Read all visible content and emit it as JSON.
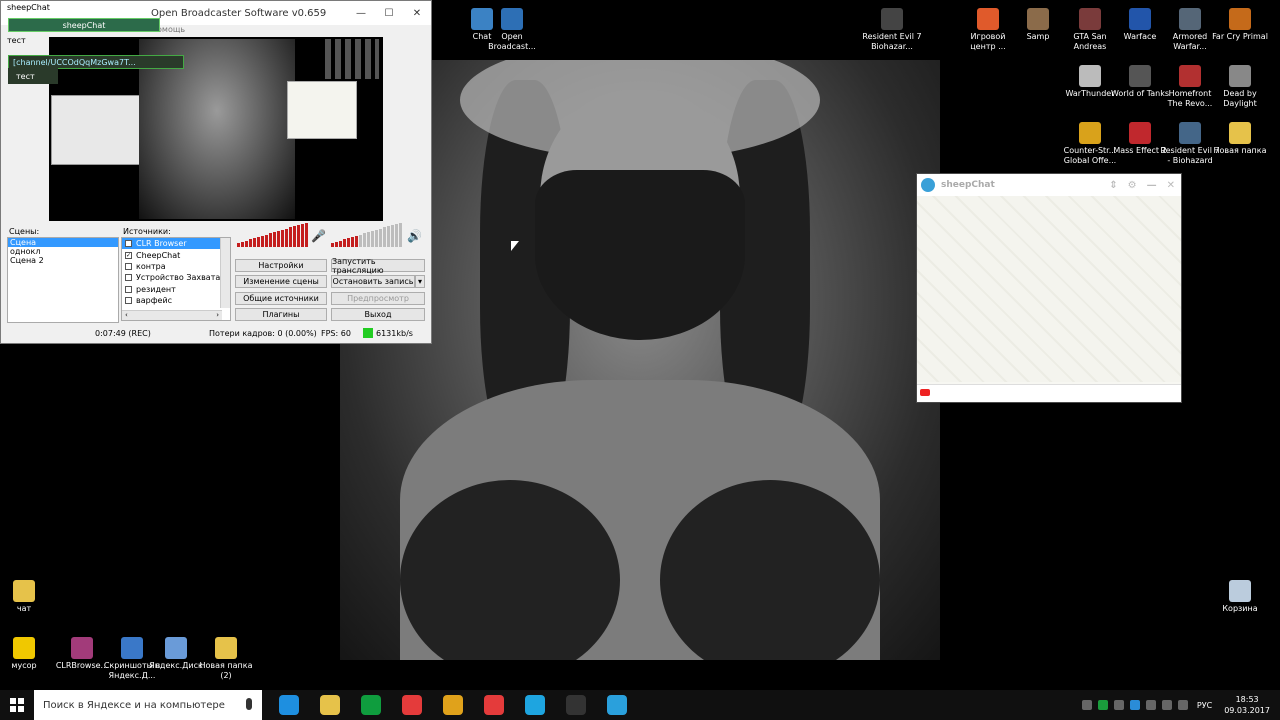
{
  "obs": {
    "title": "Open Broadcaster Software v0.659",
    "menu_help": "Помощь",
    "scenes_label": "Сцены:",
    "sources_label": "Источники:",
    "scenes": [
      "Сцена",
      "однокл",
      "Сцена 2"
    ],
    "sources": [
      {
        "label": "CLR Browser",
        "checked": true
      },
      {
        "label": "CheepChat",
        "checked": true
      },
      {
        "label": "контра",
        "checked": false
      },
      {
        "label": "Устройство Захвата",
        "checked": false
      },
      {
        "label": "резидент",
        "checked": false
      },
      {
        "label": "варфейс",
        "checked": false
      }
    ],
    "buttons": {
      "settings": "Настройки",
      "start_stream": "Запустить трансляцию",
      "edit_scene": "Изменение сцены",
      "stop_record": "Остановить запись",
      "global_sources": "Общие источники",
      "preview": "Предпросмотр",
      "plugins": "Плагины",
      "exit": "Выход"
    },
    "status": {
      "time": "0:07:49 (REC)",
      "dropped": "Потери кадров: 0 (0.00%)",
      "fps": "FPS: 60",
      "bitrate": "6131kb/s"
    }
  },
  "overlay": {
    "chat_name": "sheepChat",
    "channel": "[channel/UCCOdQqMzGwa7T...",
    "msg1": "тест",
    "msg2": "тест",
    "top_left_text": "sheepChat"
  },
  "sheepchat": {
    "title": "sheepChat"
  },
  "desktop_icons": [
    {
      "label": "Chat",
      "icon": "app-icon",
      "color": "#3b82c4"
    },
    {
      "label": "Open Broadcast...",
      "icon": "obs-icon",
      "color": "#2d6fb5"
    },
    {
      "label": "Resident Evil 7 Biohazar...",
      "icon": "game-icon",
      "color": "#444"
    },
    {
      "label": "Игровой центр ...",
      "icon": "game-center-icon",
      "color": "#e05a2b"
    },
    {
      "label": "Samp",
      "icon": "samp-icon",
      "color": "#8b6b4a"
    },
    {
      "label": "GTA San Andreas",
      "icon": "gta-icon",
      "color": "#7a3b3b"
    },
    {
      "label": "Warface",
      "icon": "warface-icon",
      "color": "#2255aa"
    },
    {
      "label": "Armored Warfar...",
      "icon": "armored-icon",
      "color": "#556677"
    },
    {
      "label": "Far Cry Primal",
      "icon": "farcry-icon",
      "color": "#c56a1a"
    },
    {
      "label": "WarThunder",
      "icon": "warthunder-icon",
      "color": "#bbbbbb"
    },
    {
      "label": "World of Tanks",
      "icon": "wot-icon",
      "color": "#555555"
    },
    {
      "label": "Homefront The Revo...",
      "icon": "homefront-icon",
      "color": "#b23030"
    },
    {
      "label": "Dead by Daylight",
      "icon": "dbd-icon",
      "color": "#888888"
    },
    {
      "label": "Counter-Str... Global Offe...",
      "icon": "csgo-icon",
      "color": "#d9a21b"
    },
    {
      "label": "Mass Effect 2",
      "icon": "masseffect-icon",
      "color": "#c0282d"
    },
    {
      "label": "Resident Evil 7 - Biohazard",
      "icon": "re7-icon",
      "color": "#446688"
    },
    {
      "label": "Новая папка",
      "icon": "folder-icon",
      "color": "#e6c24a"
    },
    {
      "label": "Корзина",
      "icon": "recycle-bin-icon",
      "color": "#bcd"
    },
    {
      "label": "чат",
      "icon": "folder-icon",
      "color": "#e6c24a"
    },
    {
      "label": "мусор",
      "icon": "warning-icon",
      "color": "#f0c800"
    },
    {
      "label": "CLRBrowse...",
      "icon": "archive-icon",
      "color": "#a23b7a"
    },
    {
      "label": "Скриншоты в Яндекс.Д...",
      "icon": "screenshot-icon",
      "color": "#3a78c8"
    },
    {
      "label": "Яндекс.Диск",
      "icon": "yandex-disk-icon",
      "color": "#6a9bd8"
    },
    {
      "label": "Новая папка (2)",
      "icon": "folder-icon",
      "color": "#e6c24a"
    }
  ],
  "taskbar": {
    "search_placeholder": "Поиск в Яндексе и на компьютере",
    "apps": [
      {
        "name": "edge-icon",
        "color": "#1e8fe0"
      },
      {
        "name": "explorer-icon",
        "color": "#e6c24a"
      },
      {
        "name": "store-icon",
        "color": "#0f9d3e"
      },
      {
        "name": "yandex-icon",
        "color": "#e43b3b"
      },
      {
        "name": "chrome-icon",
        "color": "#e0a21b"
      },
      {
        "name": "yandex-browser-icon",
        "color": "#e43b3b"
      },
      {
        "name": "skype-icon",
        "color": "#1ea5e0"
      },
      {
        "name": "obs-icon",
        "color": "#333333"
      },
      {
        "name": "sheepchat-icon",
        "color": "#2aa0dc"
      }
    ],
    "lang": "РУС",
    "time": "18:53",
    "date": "09.03.2017"
  }
}
